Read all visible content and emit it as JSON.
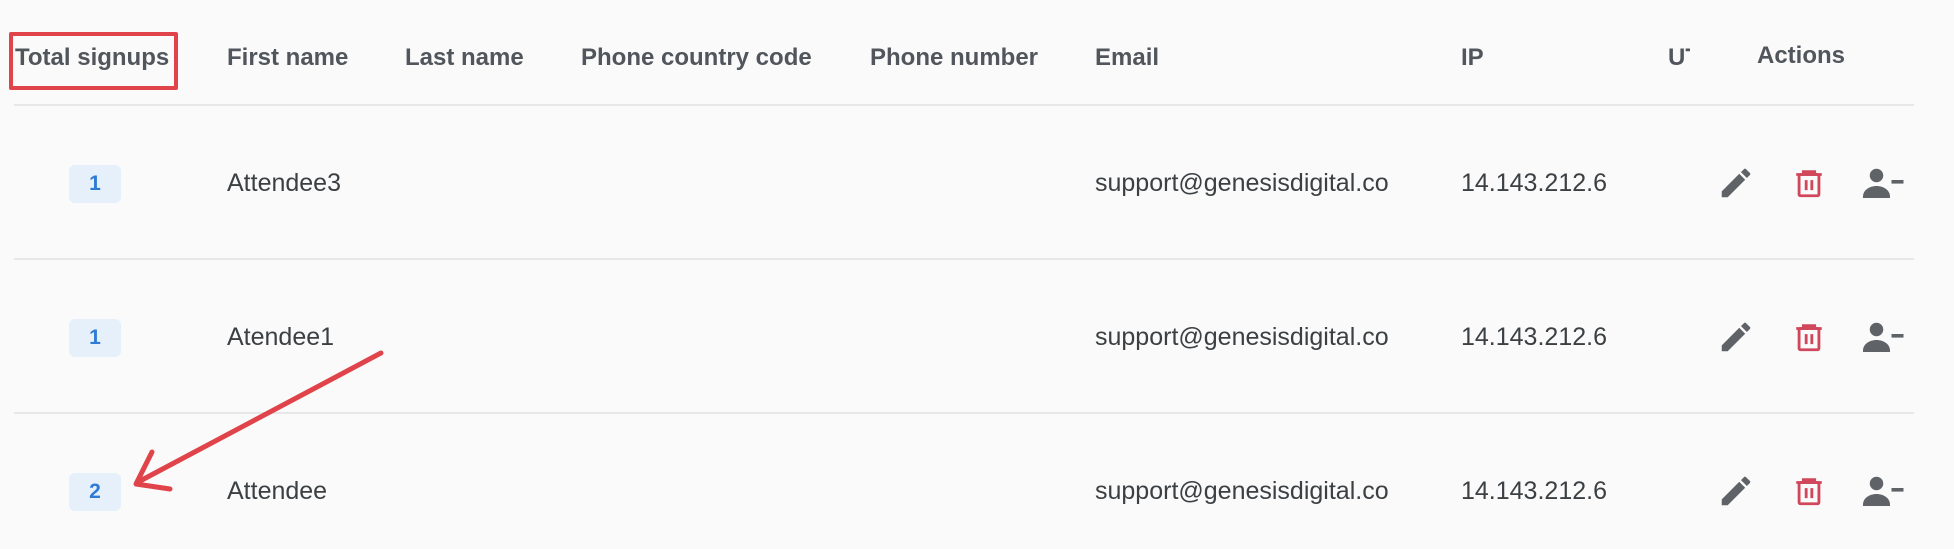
{
  "table": {
    "columns": {
      "total_signups": "Total signups",
      "first_name": "First name",
      "last_name": "Last name",
      "phone_country_code": "Phone country code",
      "phone_number": "Phone number",
      "email": "Email",
      "ip": "IP",
      "utm_truncated": "UT",
      "actions": "Actions"
    },
    "rows": [
      {
        "total_signups": "1",
        "first_name": "Attendee3",
        "last_name": "",
        "phone_country_code": "",
        "phone_number": "",
        "email": "support@genesisdigital.co",
        "ip": "14.143.212.6"
      },
      {
        "total_signups": "1",
        "first_name": "Atendee1",
        "last_name": "",
        "phone_country_code": "",
        "phone_number": "",
        "email": "support@genesisdigital.co",
        "ip": "14.143.212.6"
      },
      {
        "total_signups": "2",
        "first_name": "Attendee",
        "last_name": "",
        "phone_country_code": "",
        "phone_number": "",
        "email": "support@genesisdigital.co",
        "ip": "14.143.212.6"
      }
    ]
  },
  "icons": {
    "edit": "pencil-icon",
    "delete": "trash-icon",
    "remove_user": "person-remove-icon"
  },
  "colors": {
    "annotation_red": "#e0434a",
    "badge_bg": "#e6f0fb",
    "badge_text": "#2e7bd6",
    "delete_icon": "#d0465a",
    "action_icon": "#5f6368"
  }
}
